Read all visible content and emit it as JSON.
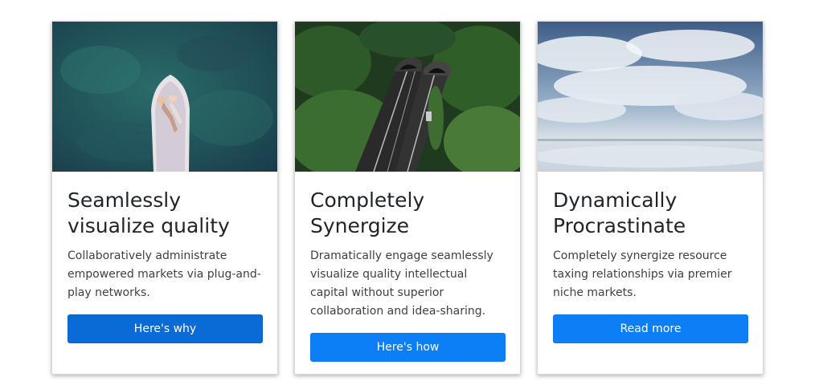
{
  "cards": [
    {
      "title": "Seamlessly visualize quality",
      "text": "Collaboratively administrate empowered markets via plug-and-play networks.",
      "button_label": "Here's why"
    },
    {
      "title": "Completely Synergize",
      "text": "Dramatically engage seamlessly visualize quality intellectual capital without superior collaboration and idea-sharing.",
      "button_label": "Here's how"
    },
    {
      "title": "Dynamically Procrastinate",
      "text": "Completely synergize resource taxing relationships via premier niche markets.",
      "button_label": "Read more"
    }
  ],
  "colors": {
    "button_primary": "#0d7ff6",
    "button_active": "#0a6ad6",
    "title_text": "#212529"
  }
}
